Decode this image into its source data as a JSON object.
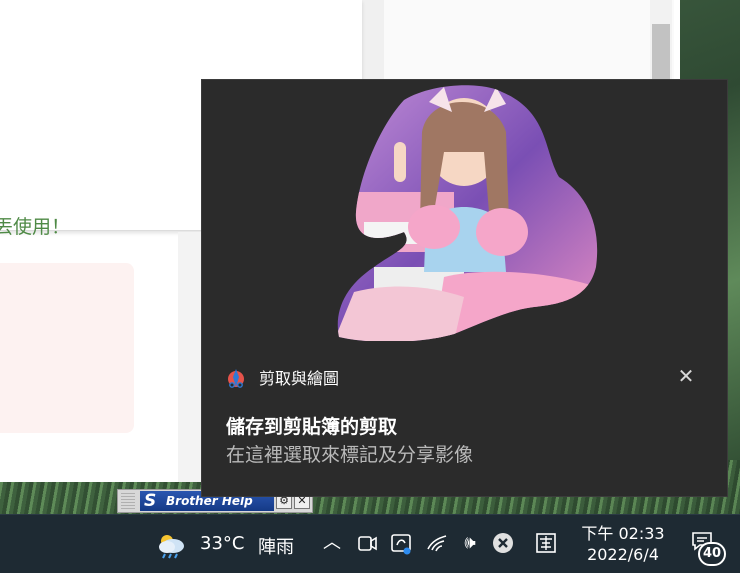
{
  "background_window": {
    "partial_text": "丟使用！"
  },
  "brother_help": {
    "label": "Brother Help",
    "logo_glyph": "S",
    "settings_glyph": "⚙",
    "close_glyph": "✕"
  },
  "toast": {
    "app_name": "剪取與繪圖",
    "title": "儲存到剪貼簿的剪取",
    "body": "在這裡選取來標記及分享影像",
    "close_glyph": "✕",
    "image": "snip-preview-image"
  },
  "taskbar": {
    "weather": {
      "temperature": "33°C",
      "condition": "陣雨",
      "icon": "partly-cloudy-rain-icon"
    },
    "tray_icons": {
      "chevron": "︿",
      "volume": "🕪"
    },
    "ime_label": "",
    "time": "下午 02:33",
    "date": "2022/6/4",
    "notification_count": "40"
  },
  "colors": {
    "toast_bg": "#2b2b2b",
    "taskbar_bg": "#1e2a33",
    "accent_green_text": "#4f8a46",
    "brother_blue": "#1f4aa0"
  }
}
